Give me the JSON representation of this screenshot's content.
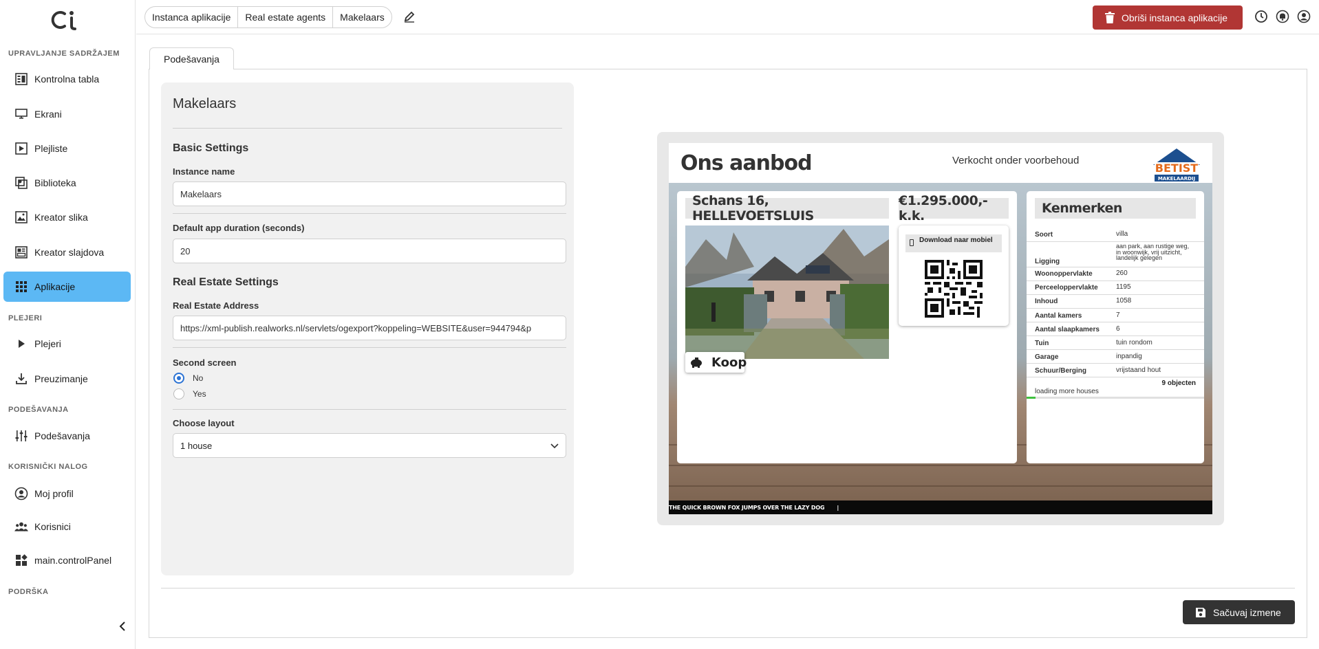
{
  "sidebar": {
    "sections": {
      "content": "UPRAVLJANJE SADRŽAJEM",
      "players": "PLEJERI",
      "settings": "PODEŠAVANJA",
      "account": "KORISNIČKI NALOG",
      "support": "PODRŠKA"
    },
    "items": [
      {
        "label": "Kontrolna tabla",
        "icon": "dashboard-icon"
      },
      {
        "label": "Ekrani",
        "icon": "monitor-icon"
      },
      {
        "label": "Plejliste",
        "icon": "playlist-icon"
      },
      {
        "label": "Biblioteka",
        "icon": "library-icon"
      },
      {
        "label": "Kreator slika",
        "icon": "image-creator-icon"
      },
      {
        "label": "Kreator slajdova",
        "icon": "slide-creator-icon"
      },
      {
        "label": "Aplikacije",
        "icon": "apps-grid-icon",
        "active": true
      },
      {
        "label": "Plejeri",
        "icon": "play-icon"
      },
      {
        "label": "Preuzimanje",
        "icon": "download-icon"
      },
      {
        "label": "Podešavanja",
        "icon": "sliders-icon"
      },
      {
        "label": "Moj profil",
        "icon": "profile-icon"
      },
      {
        "label": "Korisnici",
        "icon": "users-icon"
      },
      {
        "label": "main.controlPanel",
        "icon": "control-panel-icon"
      }
    ]
  },
  "header": {
    "breadcrumb": [
      "Instanca aplikacije",
      "Real estate agents",
      "Makelaars"
    ],
    "delete_label": "Obriši instanca aplikacije"
  },
  "tabs": [
    "Podešavanja"
  ],
  "form": {
    "title": "Makelaars",
    "basic_settings": "Basic Settings",
    "instance_name_label": "Instance name",
    "instance_name_value": "Makelaars",
    "duration_label": "Default app duration (seconds)",
    "duration_value": "20",
    "real_estate_settings": "Real Estate Settings",
    "address_label": "Real Estate Address",
    "address_value": "https://xml-publish.realworks.nl/servlets/ogexport?koppeling=WEBSITE&user=944794&p",
    "second_screen_label": "Second screen",
    "second_screen_options": [
      "No",
      "Yes"
    ],
    "second_screen_selected": "No",
    "layout_label": "Choose layout",
    "layout_value": "1 house"
  },
  "save_label": "Sačuvaj izmene",
  "preview": {
    "title": "Ons aanbod",
    "subtitle": "Verkocht onder voorbehoud",
    "logo_text": "BETIST",
    "logo_sub": "MAKELAARDIJ",
    "address": "Schans 16, HELLEVOETSLUIS",
    "price": "€1.295.000,- k.k.",
    "qr_label": "Download naar mobiel",
    "badge": "Koop",
    "features_title": "Kenmerken",
    "features": [
      {
        "k": "Soort",
        "v": "villa"
      },
      {
        "k": "Ligging",
        "v": "aan park, aan rustige weg, in woonwijk, vrij uitzicht, landelijk gelegen"
      },
      {
        "k": "Woonoppervlakte",
        "v": "260"
      },
      {
        "k": "Perceeloppervlakte",
        "v": "1195"
      },
      {
        "k": "Inhoud",
        "v": "1058"
      },
      {
        "k": "Aantal kamers",
        "v": "7"
      },
      {
        "k": "Aantal slaapkamers",
        "v": "6"
      },
      {
        "k": "Tuin",
        "v": "tuin rondom"
      },
      {
        "k": "Garage",
        "v": "inpandig"
      },
      {
        "k": "Schuur/Berging",
        "v": "vrijstaand hout"
      }
    ],
    "objects": "9 objecten",
    "loading": "loading more houses",
    "loading_progress": 0.05,
    "ticker": "THE QUICK BROWN FOX JUMPS OVER THE LAZY DOG",
    "ticker_cursor": "|"
  },
  "colors": {
    "active_nav": "#5cb8f4",
    "delete_button": "#b13634",
    "save_button": "#333333",
    "radio_checked": "#2a72d4",
    "progress": "#3fc13f"
  }
}
